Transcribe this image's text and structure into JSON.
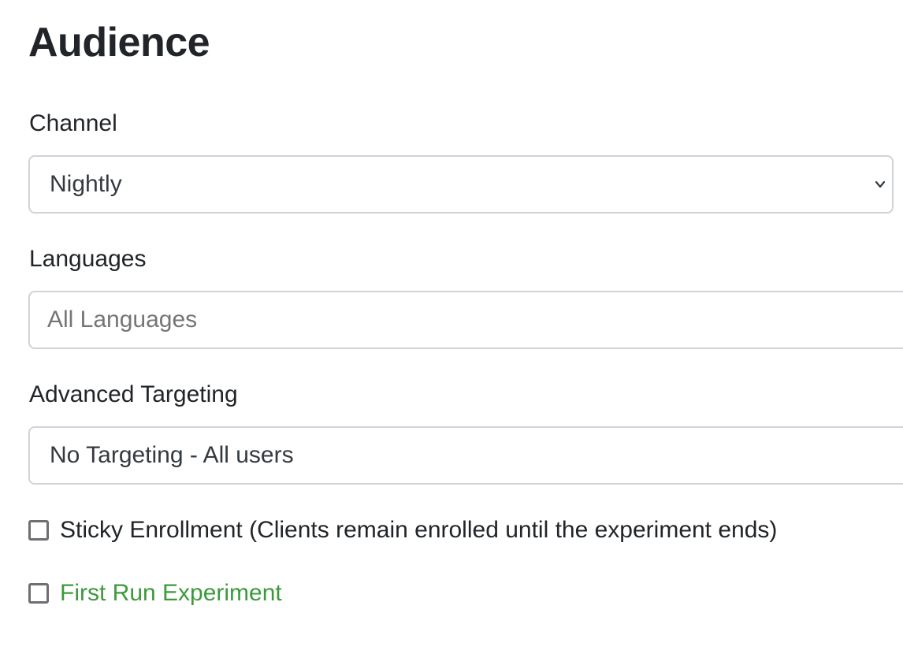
{
  "page": {
    "title": "Audience"
  },
  "channel": {
    "label": "Channel",
    "selected": "Nightly",
    "icon": "chevron-down-icon"
  },
  "languages": {
    "label": "Languages",
    "placeholder": "All Languages"
  },
  "targeting": {
    "label": "Advanced Targeting",
    "selected": "No Targeting - All users"
  },
  "options": {
    "sticky_enrollment": {
      "label": "Sticky Enrollment (Clients remain enrolled until the experiment ends)",
      "checked": false
    },
    "first_run": {
      "label": "First Run Experiment",
      "checked": false,
      "color": "#3c9a3c"
    }
  }
}
